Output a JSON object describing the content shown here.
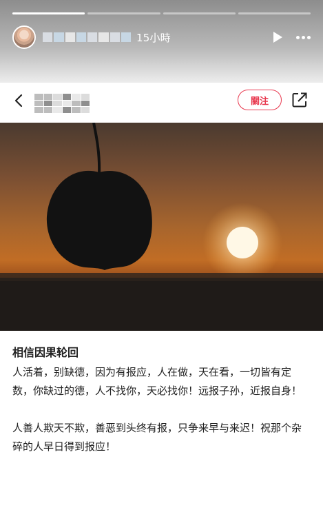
{
  "story": {
    "progress": [
      1,
      0,
      0,
      0
    ],
    "time_label": "15小時",
    "colors": {
      "progress_bg": "#ffffff",
      "header_text": "#ffffff"
    },
    "icons": {
      "play": "play-icon",
      "more": "more-icon"
    }
  },
  "card": {
    "follow_label": "關注",
    "accent": "#e8384e",
    "icons": {
      "back": "chevron-left-icon",
      "share": "share-icon"
    }
  },
  "post": {
    "title": "相信因果轮回",
    "paragraphs": [
      "人活着，别缺德，因为有报应，人在做，天在看，一切皆有定数，你缺过的德，人不找你，天必找你！远报子孙，近报自身！",
      "人善人欺天不欺，善恶到头终有报，只争来早与来迟！祝那个杂碎的人早日得到报应！"
    ]
  }
}
